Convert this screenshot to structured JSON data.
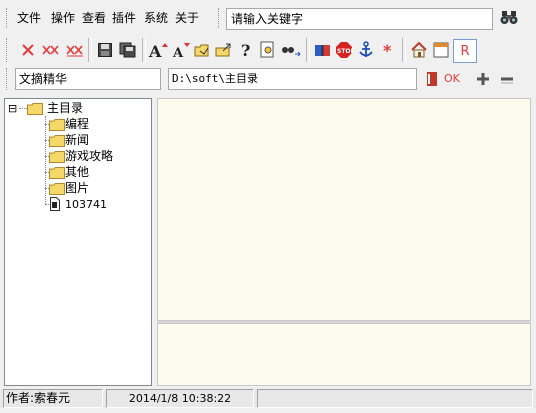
{
  "menu": {
    "items": [
      "文件",
      "操作",
      "查看",
      "插件",
      "系统",
      "关于"
    ]
  },
  "search": {
    "value": "请输入关键字"
  },
  "toolbar": {
    "format_ok_label": "OK",
    "right_label": "R"
  },
  "pathbar": {
    "title_value": "文摘精华",
    "path_value": "D:\\soft\\主目录",
    "go_label": "OK"
  },
  "tree": {
    "root": "主目录",
    "children": [
      "编程",
      "新闻",
      "游戏攻略",
      "其他",
      "图片"
    ],
    "file": "103741",
    "expander": "⊟"
  },
  "status": {
    "author": "作者:索春元",
    "datetime": "2014/1/8 10:38:22",
    "extra": ""
  },
  "colors": {
    "accent_red": "#e83a3a",
    "folder_yellow": "#f5d76a",
    "content_bg": "#fdfaee"
  }
}
